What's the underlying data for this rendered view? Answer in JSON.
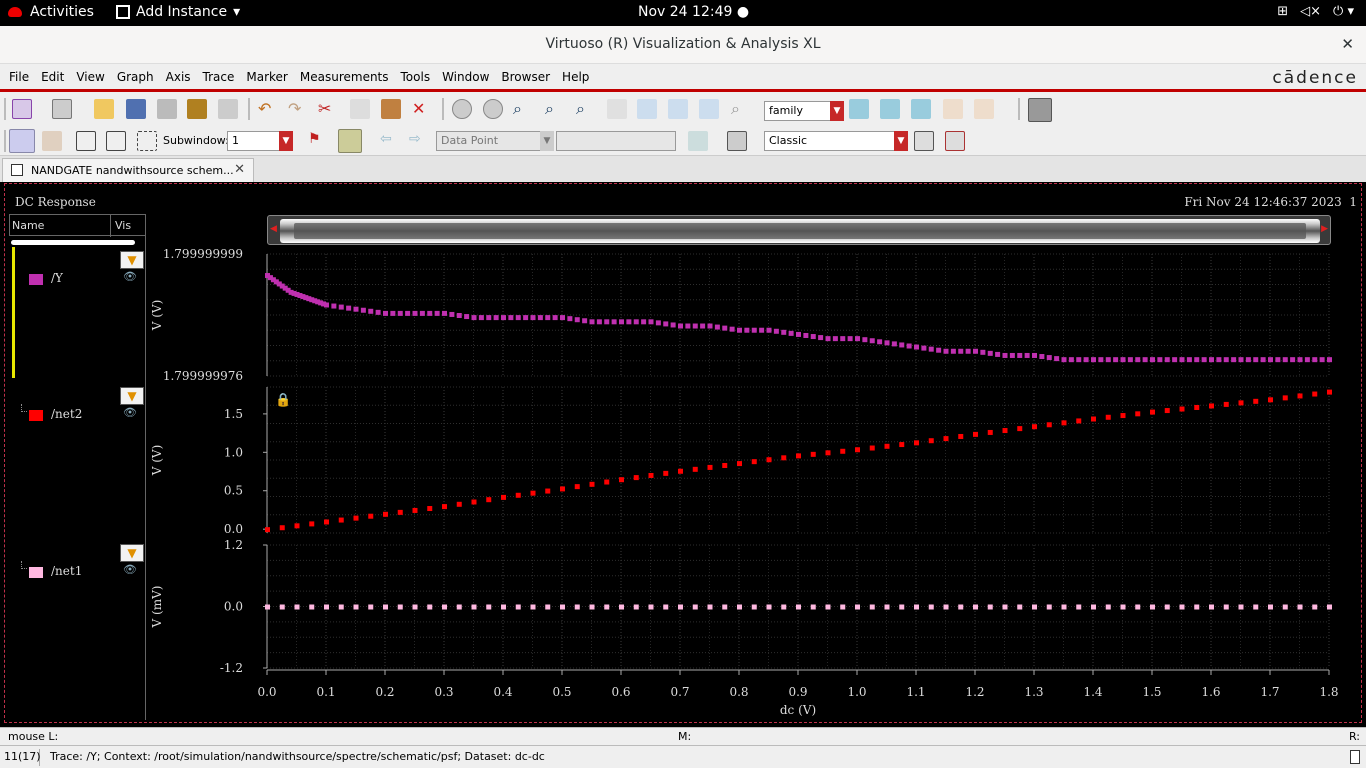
{
  "gnome": {
    "activities": "Activities",
    "app_menu": "Add Instance",
    "clock": "Nov 24  12:49 ●"
  },
  "window": {
    "title": "Virtuoso (R) Visualization & Analysis XL",
    "close": "✕"
  },
  "menu": {
    "items": [
      "File",
      "Edit",
      "View",
      "Graph",
      "Axis",
      "Trace",
      "Marker",
      "Measurements",
      "Tools",
      "Window",
      "Browser",
      "Help"
    ],
    "brand": "cādence"
  },
  "toolbar": {
    "family_combo": "family",
    "subwindow_label": "Subwindow:",
    "subwindow_value": "1",
    "datapoint_placeholder": "Data Point",
    "style_combo": "Classic"
  },
  "tab": {
    "label": "NANDGATE nandwithsource schem...",
    "close": "✕"
  },
  "plot": {
    "title": "DC Response",
    "datetime": "Fri Nov 24 12:46:37 2023",
    "corner": "1",
    "legend_name": "Name",
    "legend_vis": "Vis",
    "traces": [
      {
        "name": "/Y",
        "color": "#c030b0"
      },
      {
        "name": "/net2",
        "color": "#ff0000"
      },
      {
        "name": "/net1",
        "color": "#ffb8e0"
      }
    ]
  },
  "chart_data": [
    {
      "type": "scatter",
      "series": [
        {
          "name": "/Y",
          "color": "#c030b0",
          "x": [
            0.0,
            0.02,
            0.04,
            0.06,
            0.08,
            0.1,
            0.15,
            0.2,
            0.25,
            0.3,
            0.35,
            0.4,
            0.45,
            0.5,
            0.55,
            0.6,
            0.65,
            0.7,
            0.75,
            0.8,
            0.85,
            0.9,
            0.95,
            1.0,
            1.05,
            1.1,
            1.15,
            1.2,
            1.25,
            1.3,
            1.35,
            1.4,
            1.45,
            1.5,
            1.55,
            1.6,
            1.65,
            1.7,
            1.75,
            1.8
          ],
          "y": [
            1.7999999985,
            1.7999999983,
            1.7999999981,
            1.799999998,
            1.7999999979,
            1.7999999978,
            1.7999999977,
            1.7999999976,
            1.7999999976,
            1.7999999976,
            1.7999999975,
            1.7999999975,
            1.7999999975,
            1.7999999975,
            1.7999999974,
            1.7999999974,
            1.7999999974,
            1.7999999973,
            1.7999999973,
            1.7999999972,
            1.7999999972,
            1.7999999971,
            1.799999997,
            1.799999997,
            1.7999999969,
            1.7999999968,
            1.7999999967,
            1.7999999967,
            1.7999999966,
            1.7999999966,
            1.7999999965,
            1.7999999965,
            1.7999999965,
            1.7999999965,
            1.7999999965,
            1.7999999965,
            1.7999999965,
            1.7999999965,
            1.7999999965,
            1.7999999965
          ]
        }
      ],
      "ylabel": "V (V)",
      "yticks": [
        "1.799999999",
        "1.799999976"
      ],
      "ylim": [
        1.7999999961,
        1.799999999
      ]
    },
    {
      "type": "scatter",
      "series": [
        {
          "name": "/net2",
          "color": "#ff0000",
          "x": [
            0.0,
            0.1,
            0.2,
            0.3,
            0.4,
            0.5,
            0.6,
            0.7,
            0.8,
            0.9,
            1.0,
            1.1,
            1.2,
            1.3,
            1.4,
            1.5,
            1.6,
            1.7,
            1.8
          ],
          "y": [
            0.0,
            0.1,
            0.2,
            0.3,
            0.42,
            0.53,
            0.65,
            0.76,
            0.86,
            0.96,
            1.04,
            1.13,
            1.24,
            1.34,
            1.44,
            1.53,
            1.61,
            1.69,
            1.79
          ]
        }
      ],
      "ylabel": "V (V)",
      "yticks": [
        "0.0",
        "0.5",
        "1.0",
        "1.5"
      ],
      "ylim": [
        -0.05,
        1.85
      ]
    },
    {
      "type": "scatter",
      "series": [
        {
          "name": "/net1",
          "color": "#ffb8e0",
          "x": [
            0.0,
            1.8
          ],
          "y": [
            0.0,
            0.0
          ]
        }
      ],
      "ylabel": "V (mV)",
      "yticks": [
        "1.2",
        "0.0",
        "-1.2"
      ],
      "ylim": [
        -1.2,
        1.2
      ]
    }
  ],
  "xaxis": {
    "label": "dc (V)",
    "ticks": [
      "0.0",
      "0.1",
      "0.2",
      "0.3",
      "0.4",
      "0.5",
      "0.6",
      "0.7",
      "0.8",
      "0.9",
      "1.0",
      "1.1",
      "1.2",
      "1.3",
      "1.4",
      "1.5",
      "1.6",
      "1.7",
      "1.8"
    ]
  },
  "status": {
    "left": "mouse L:",
    "middle": "M:",
    "right": "R:",
    "count": "11(17)",
    "message": "Trace: /Y; Context: /root/simulation/nandwithsource/spectre/schematic/psf; Dataset: dc-dc"
  }
}
